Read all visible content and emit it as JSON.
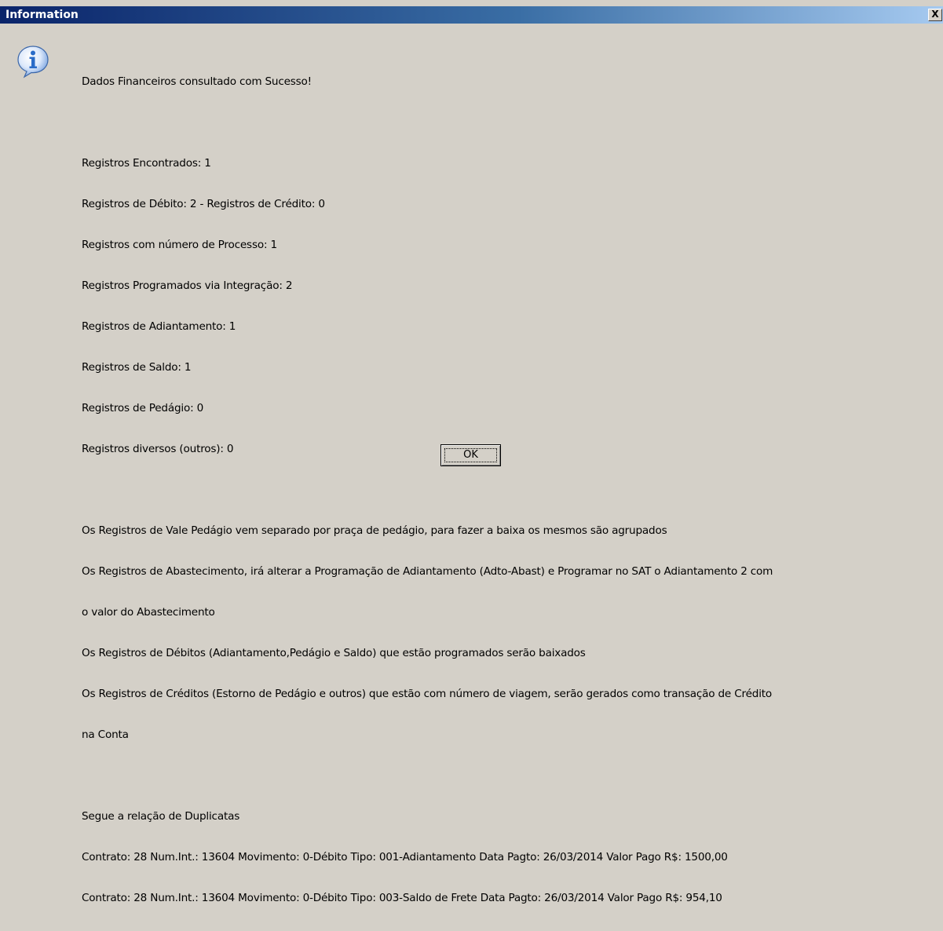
{
  "window": {
    "title": "Information",
    "close_label": "X"
  },
  "icon": {
    "name": "info-icon"
  },
  "message": {
    "lines": [
      "Dados Financeiros consultado com Sucesso!",
      "",
      "Registros Encontrados: 1",
      "Registros de Débito: 2 - Registros de Crédito: 0",
      "Registros com número de Processo: 1",
      "Registros Programados via Integração: 2",
      "Registros de Adiantamento: 1",
      "Registros de Saldo: 1",
      "Registros de Pedágio: 0",
      "Registros diversos (outros): 0",
      "",
      "Os Registros de Vale Pedágio vem separado por praça de pedágio, para fazer a baixa os mesmos são agrupados",
      "Os Registros de Abastecimento, irá alterar a Programação de Adiantamento (Adto-Abast) e Programar no SAT o Adiantamento 2 com",
      "o valor do Abastecimento",
      "Os Registros de Débitos (Adiantamento,Pedágio e Saldo) que estão programados serão baixados",
      "Os Registros de Créditos (Estorno de Pedágio e outros) que estão com número de viagem, serão gerados como transação de Crédito",
      "na Conta",
      "",
      "Segue a relação de Duplicatas",
      "Contrato: 28 Num.Int.: 13604 Movimento: 0-Débito Tipo: 001-Adiantamento Data Pagto: 26/03/2014 Valor Pago R$: 1500,00",
      "Contrato: 28 Num.Int.: 13604 Movimento: 0-Débito Tipo: 003-Saldo de Frete Data Pagto: 26/03/2014 Valor Pago R$: 954,10"
    ]
  },
  "buttons": {
    "ok_label": "OK"
  },
  "colors": {
    "titlebar_start": "#0a246a",
    "titlebar_end": "#a6caf0",
    "dialog_bg": "#d4d0c8",
    "icon_blue": "#2a6cc8"
  }
}
